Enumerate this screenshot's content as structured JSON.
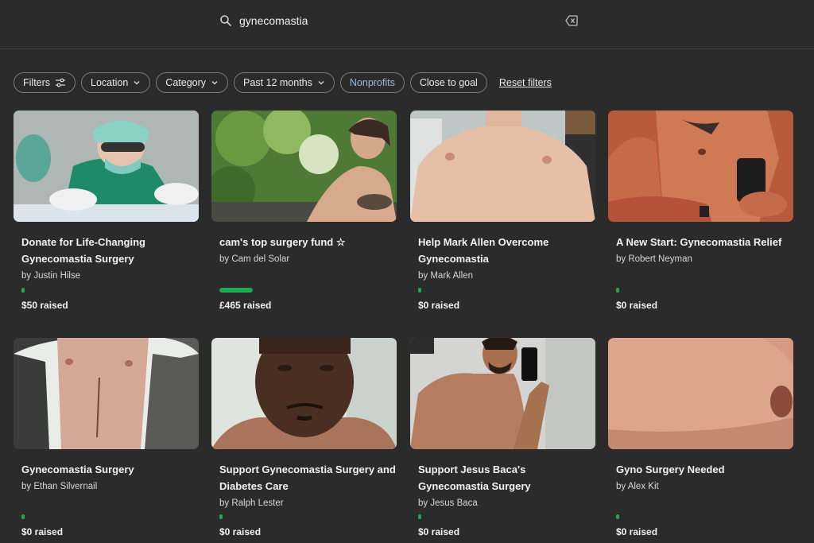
{
  "search": {
    "query": "gynecomastia"
  },
  "filters": {
    "chips": [
      {
        "label": "Filters",
        "icon": "sliders-icon"
      },
      {
        "label": "Location",
        "icon": "chevron-down-icon"
      },
      {
        "label": "Category",
        "icon": "chevron-down-icon"
      },
      {
        "label": "Past 12 months",
        "icon": "chevron-down-icon"
      },
      {
        "label": "Nonprofits",
        "icon": ""
      },
      {
        "label": "Close to goal",
        "icon": ""
      }
    ],
    "reset_label": "Reset filters"
  },
  "colors": {
    "accent": "#1fa84f",
    "nonprofit_text": "#9ab7e8",
    "background": "#2b2b2b"
  },
  "cards": [
    {
      "title": "Donate for Life-Changing Gynecomastia Surgery",
      "byline": "by Justin Hilse",
      "raised": "$50 raised",
      "progress": 0.01
    },
    {
      "title": "cam's top surgery fund ☆",
      "byline": "by Cam del Solar",
      "raised": "£465 raised",
      "progress": 0.18
    },
    {
      "title": "Help Mark Allen Overcome Gynecomastia",
      "byline": "by Mark Allen",
      "raised": "$0 raised",
      "progress": 0.01
    },
    {
      "title": "A New Start: Gynecomastia Relief",
      "byline": "by Robert Neyman",
      "raised": "$0 raised",
      "progress": 0.01
    },
    {
      "title": "Gynecomastia Surgery",
      "byline": "by Ethan Silvernail",
      "raised": "$0 raised",
      "progress": 0.01
    },
    {
      "title": "Support Gynecomastia Surgery and Diabetes Care",
      "byline": "by Ralph Lester",
      "raised": "$0 raised",
      "progress": 0.01
    },
    {
      "title": "Support Jesus Baca's Gynecomastia Surgery",
      "byline": "by Jesus Baca",
      "raised": "$0 raised",
      "progress": 0.01
    },
    {
      "title": "Gyno Surgery Needed",
      "byline": "by Alex Kit",
      "raised": "$0 raised",
      "progress": 0.01
    }
  ]
}
